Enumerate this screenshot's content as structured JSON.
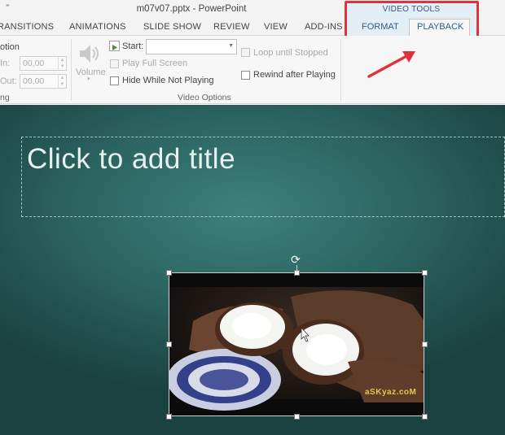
{
  "window": {
    "qat_glyph": "⁼",
    "title": "m07v07.pptx - PowerPoint"
  },
  "tabs": [
    "RANSITIONS",
    "ANIMATIONS",
    "SLIDE SHOW",
    "REVIEW",
    "VIEW",
    "ADD-INS"
  ],
  "video_tools": {
    "label": "VIDEO TOOLS",
    "format_tab": "FORMAT",
    "playback_tab": "PLAYBACK",
    "active_tab": "PLAYBACK"
  },
  "ribbon": {
    "editing": {
      "partial_label": "otion",
      "fade_in_label": "In:",
      "fade_in_value": "00,00",
      "fade_out_label": "Out:",
      "fade_out_value": "00,00",
      "group_label": "ng"
    },
    "volume_label": "Volume",
    "start_label": "Start:",
    "start_value": "",
    "play_full_screen": "Play Full Screen",
    "hide_while_not_playing": "Hide While Not Playing",
    "loop_until_stopped": "Loop until Stopped",
    "rewind_after_playing": "Rewind after Playing",
    "video_options_label": "Video Options"
  },
  "slide": {
    "title_placeholder": "Click to add title",
    "watermark": "aSKyaz.coM"
  },
  "annotation": {
    "highlight_color": "#e0323c",
    "arrow_color": "#e0323c"
  }
}
